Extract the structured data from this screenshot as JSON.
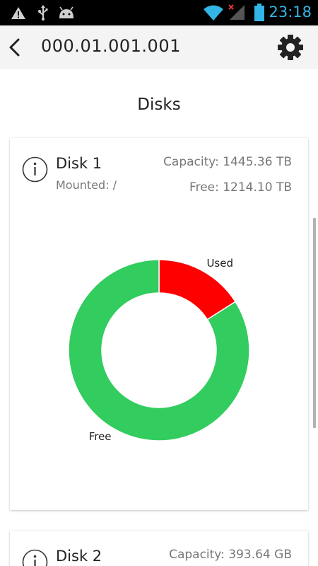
{
  "status_bar": {
    "time": "23:18",
    "left_icons": [
      "warning-icon",
      "usb-icon",
      "android-icon"
    ],
    "right_icons": [
      "wifi-icon",
      "signal-no-service-icon",
      "battery-icon"
    ]
  },
  "app_bar": {
    "title": "000.01.001.001",
    "back_icon": "chevron-left-icon",
    "settings_icon": "gear-icon"
  },
  "page": {
    "section_title": "Disks"
  },
  "disks": [
    {
      "name": "Disk 1",
      "mounted": "Mounted: /",
      "capacity": "Capacity: 1445.36 TB",
      "free": "Free: 1214.10 TB"
    },
    {
      "name": "Disk 2",
      "capacity": "Capacity: 393.64 GB"
    }
  ],
  "colors": {
    "used": "#ff0000",
    "free": "#33cc5f",
    "status_accent": "#33b5e5"
  },
  "chart_data": {
    "type": "pie",
    "labels": [
      "Used",
      "Free"
    ],
    "values": [
      231.26,
      1214.1
    ],
    "colors": [
      "#ff0000",
      "#33cc5f"
    ]
  }
}
